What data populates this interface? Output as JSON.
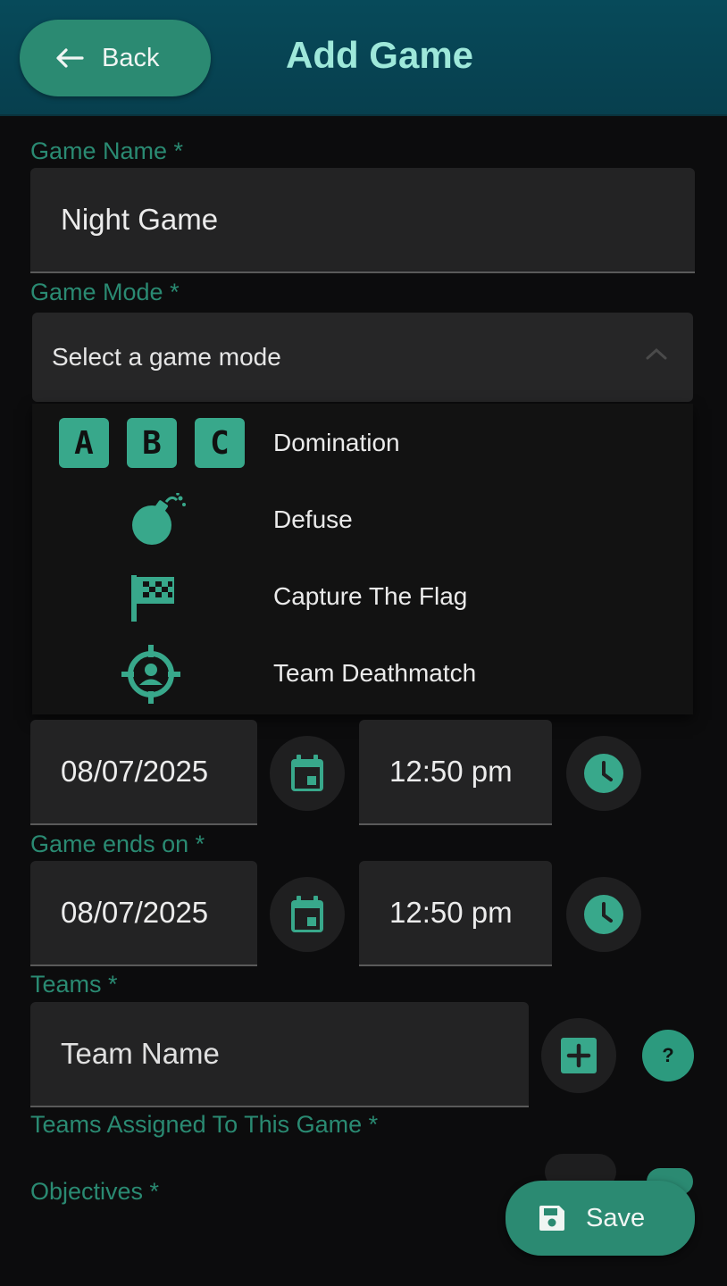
{
  "header": {
    "back_label": "Back",
    "title": "Add Game"
  },
  "form": {
    "game_name": {
      "label": "Game Name *",
      "value": "Night Game"
    },
    "game_mode": {
      "label": "Game Mode *",
      "placeholder": "Select a game mode",
      "options": [
        {
          "label": "Domination",
          "icon": "abc-letters-icon",
          "letters": [
            "A",
            "B",
            "C"
          ]
        },
        {
          "label": "Defuse",
          "icon": "bomb-icon"
        },
        {
          "label": "Capture The Flag",
          "icon": "checkered-flag-icon"
        },
        {
          "label": "Team Deathmatch",
          "icon": "crosshair-person-icon"
        }
      ]
    },
    "game_starts": {
      "date": "08/07/2025",
      "time": "12:50 pm"
    },
    "game_ends": {
      "label": "Game ends on *",
      "date": "08/07/2025",
      "time": "12:50 pm"
    },
    "teams": {
      "label": "Teams *",
      "placeholder": "Team Name",
      "help": "?"
    },
    "teams_assigned": {
      "label": "Teams Assigned To This Game *"
    },
    "objectives": {
      "label": "Objectives *"
    }
  },
  "save_label": "Save",
  "colors": {
    "accent": "#2b8a72",
    "icon_green": "#38a88b",
    "label_green": "#2a8a72",
    "header_bg": "#074a5a"
  }
}
